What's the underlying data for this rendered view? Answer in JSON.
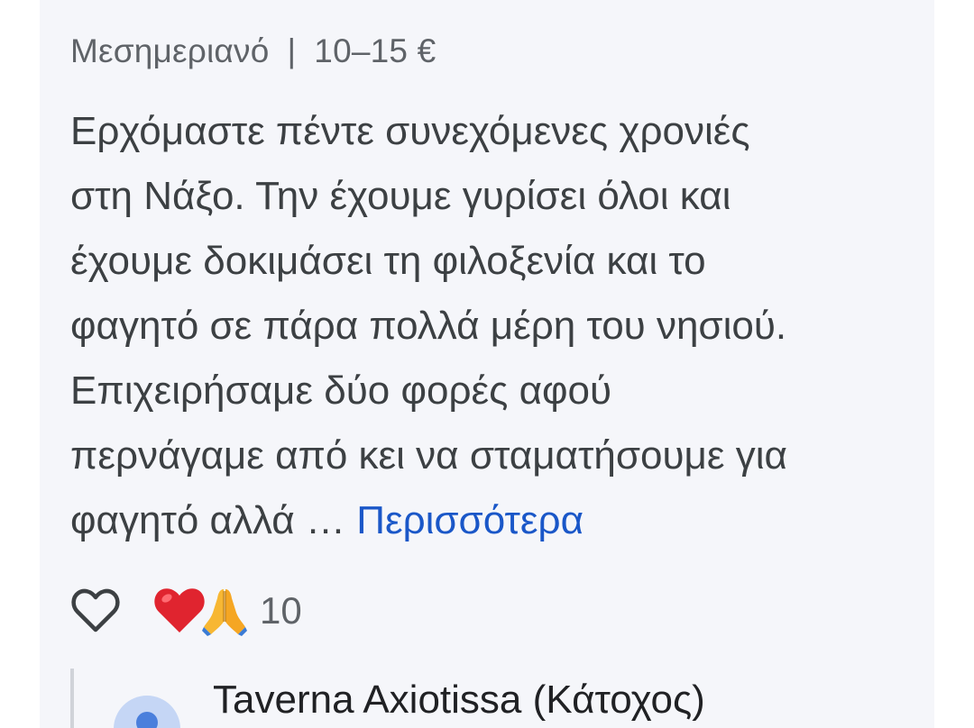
{
  "meta": {
    "meal": "Μεσημεριανό",
    "separator": "|",
    "price": "10–15 €"
  },
  "review": {
    "lines": [
      "Ερχόμαστε πέντε συνεχόμενες χρονιές",
      "στη Νάξο. Την έχουμε γυρίσει όλοι και",
      "έχουμε δοκιμάσει τη φιλοξενία και το",
      "φαγητό σε πάρα πολλά μέρη του νησιού.",
      "Επιχειρήσαμε δύο φορές αφού",
      "περνάγαμε από κει να σταματήσουμε για",
      "φαγητό αλλά …"
    ],
    "more_label": "Περισσότερα"
  },
  "reactions": {
    "like_icon": "heart-outline-icon",
    "emojis": [
      "red-heart-emoji",
      "folded-hands-emoji"
    ],
    "count": "10"
  },
  "reply": {
    "owner_name": "Taverna Axiotissa (Κάτοχος)"
  },
  "colors": {
    "card_bg": "#f5f6fa",
    "link": "#1a57c8",
    "text": "#3c4043",
    "muted": "#5f6368"
  }
}
